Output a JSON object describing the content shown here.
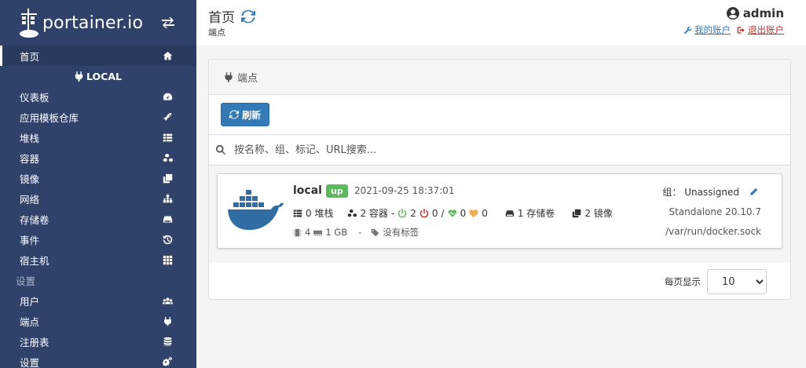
{
  "brand": {
    "name": "portainer.io"
  },
  "sidebar": {
    "home": "首页",
    "endpoint": "LOCAL",
    "items": [
      {
        "label": "仪表板",
        "icon": "tachometer-icon"
      },
      {
        "label": "应用模板仓库",
        "icon": "rocket-icon"
      },
      {
        "label": "堆栈",
        "icon": "th-list-icon"
      },
      {
        "label": "容器",
        "icon": "cubes-icon"
      },
      {
        "label": "镜像",
        "icon": "clone-icon"
      },
      {
        "label": "网络",
        "icon": "sitemap-icon"
      },
      {
        "label": "存储卷",
        "icon": "hdd-icon"
      },
      {
        "label": "事件",
        "icon": "history-icon"
      },
      {
        "label": "宿主机",
        "icon": "th-icon"
      }
    ],
    "settings_section": "设置",
    "settings_items": [
      {
        "label": "用户",
        "icon": "users-icon"
      },
      {
        "label": "端点",
        "icon": "plug-icon"
      },
      {
        "label": "注册表",
        "icon": "database-icon"
      },
      {
        "label": "设置",
        "icon": "cogs-icon"
      }
    ]
  },
  "header": {
    "title": "首页",
    "subtitle": "端点",
    "username": "admin",
    "my_account": "我的账户",
    "logout": "退出账户"
  },
  "panel": {
    "title": "端点",
    "refresh_label": "刷新",
    "search_placeholder": "按名称、组、标记、URL搜索..."
  },
  "endpoint": {
    "name": "local",
    "status": "up",
    "timestamp": "2021-09-25 18:37:01",
    "stacks": "0 堆栈",
    "containers": "2 容器",
    "running": "2",
    "stopped": "0",
    "slash": "/",
    "healthy": "0",
    "unhealthy": "0",
    "volumes": "1 存储卷",
    "images": "2 镜像",
    "cpu": "4",
    "memory": "1 GB",
    "dash": "-",
    "tags": "没有标签",
    "group": "组： Unassigned",
    "version": "Standalone 20.10.7",
    "socket": "/var/run/docker.sock"
  },
  "pager": {
    "label": "每页显示",
    "value": "10"
  },
  "colors": {
    "sidebar": "#30426a",
    "primary": "#337ab7",
    "success": "#5cb85c",
    "danger": "#c9302c",
    "warning": "#f0ad4e"
  }
}
